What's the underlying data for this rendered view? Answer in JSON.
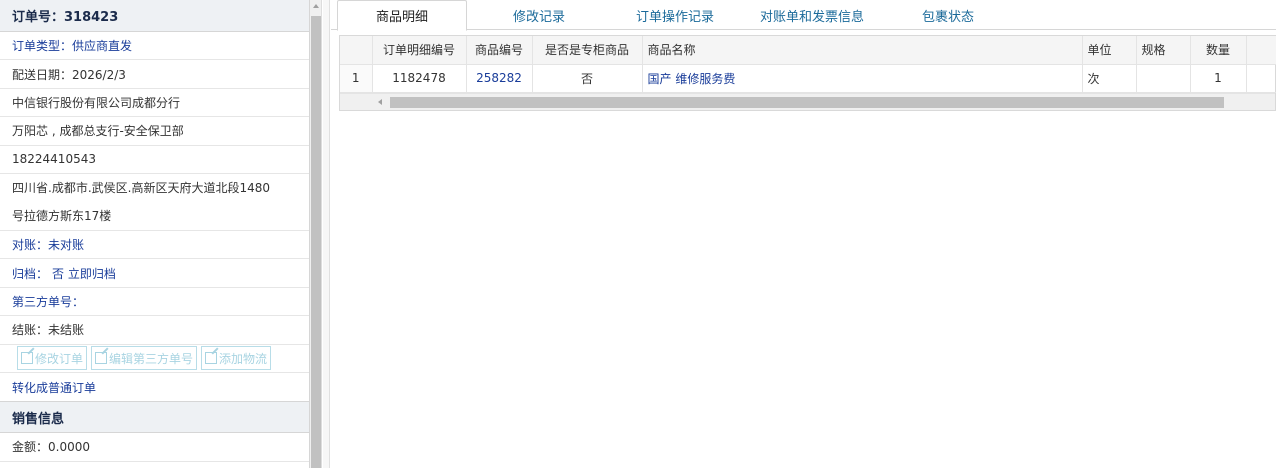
{
  "order": {
    "header": "订单号：318423",
    "type_line": "订单类型：供应商直发",
    "delivery_date": "配送日期：2026/2/3",
    "company": "中信银行股份有限公司成都分行",
    "contact": "万阳芯 , 成都总支行-安全保卫部",
    "phone": "18224410543",
    "address_line1": "四川省.成都市.武侯区.高新区天府大道北段1480",
    "address_line2": "号拉德方斯东17楼",
    "reconcile": "对账：未对账",
    "archive_label": "归档：",
    "archive_value": "否 立即归档",
    "third_party": "第三方单号：",
    "settle": "结账：未结账",
    "buttons": {
      "edit_order": "修改订单",
      "edit_third": "编辑第三方单号",
      "add_logistics": "添加物流"
    },
    "convert_link": "转化成普通订单"
  },
  "sales": {
    "header": "销售信息",
    "amount": "金额：0.0000"
  },
  "tabs": [
    {
      "label": "商品明细"
    },
    {
      "label": "修改记录"
    },
    {
      "label": "订单操作记录"
    },
    {
      "label": "对账单和发票信息"
    },
    {
      "label": "包裹状态"
    }
  ],
  "table": {
    "columns": [
      "",
      "订单明细编号",
      "商品编号",
      "是否是专柜商品",
      "商品名称",
      "单位",
      "规格",
      "数量"
    ],
    "rows": [
      {
        "rn": "1",
        "detail_id": "1182478",
        "product_id": "258282",
        "counter": "否",
        "name": "国产 维修服务费",
        "unit": "次",
        "spec": "",
        "qty": "1"
      }
    ]
  }
}
